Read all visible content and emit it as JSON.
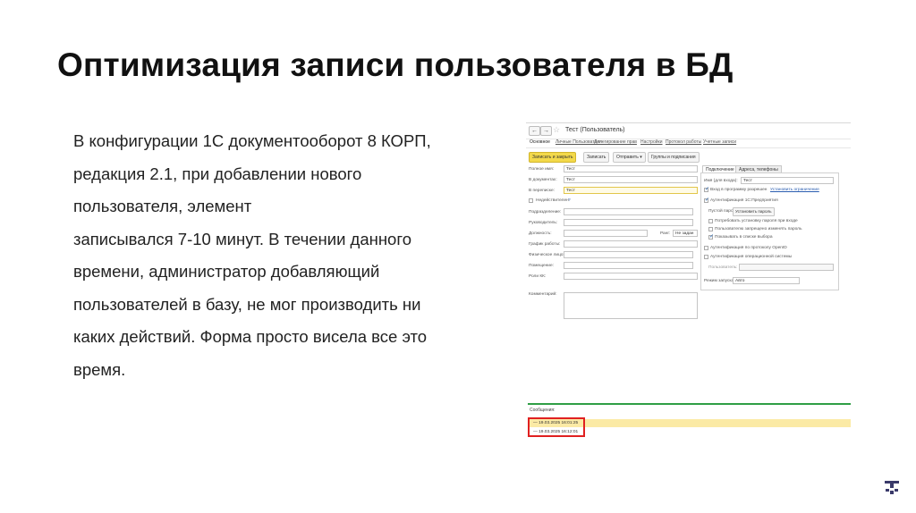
{
  "slide": {
    "title": "Оптимизация записи пользователя в БД",
    "body_lines": [
      "В конфигурации 1С документооборот 8 КОРП,",
      "редакция 2.1, при добавлении нового",
      "пользователя, элемент",
      "записывался 7-10 минут. В течении данного",
      "времени, администратор добавляющий",
      "пользователей в базу, не мог производить ни",
      "каких действий. Форма просто висела все это",
      "время."
    ]
  },
  "screenshot": {
    "nav_back": "←",
    "nav_forward": "→",
    "window_title": "Тест (Пользователь)",
    "tabs": [
      "Основное",
      "Личные Пользователя",
      "Делегирование прав",
      "Настройки",
      "Протокол работы",
      "Учетные записи"
    ],
    "buttons": {
      "save_close": "Записать и закрыть",
      "save": "Записать",
      "send": "Отправить",
      "groups": "Группы и подписания"
    },
    "left_form": {
      "full_name_label": "Полное имя:",
      "full_name_value": "Тест",
      "in_documents_label": "В документах:",
      "in_documents_value": "Тест",
      "in_correspondence_label": "В переписке:",
      "in_correspondence_value": "Тест",
      "invalid_label": "Недействителен",
      "invalid_hint": "?",
      "department_label": "Подразделение:",
      "manager_label": "Руководитель:",
      "position_label": "Должность:",
      "rank_label": "Ранг:",
      "rank_value": "Не задан",
      "schedule_label": "График работы:",
      "individual_label": "Физическое лицо:",
      "room_label": "Помещение:",
      "roles_label": "Роли КК:",
      "comment_label": "Комментарий:"
    },
    "right_tabs": [
      "Подключение",
      "Адреса, телефоны"
    ],
    "right_form": {
      "login_label": "Имя (для входа):",
      "login_value": "Тест",
      "access_label": "Вход в программу разрешен",
      "set_restriction": "Установить ограничение",
      "auth_1c_label": "Аутентификация 1С:Предприятия",
      "empty_password_label": "Пустой пароль",
      "set_password_btn": "Установить пароль",
      "require_password_change": "Потребовать установку пароля при входе",
      "forbid_password_change": "Пользователю запрещено изменять пароль",
      "show_in_list": "Показывать в списке выбора",
      "openid_auth": "Аутентификация по протоколу OpenID",
      "os_auth": "Аутентификация операционной системы",
      "os_user_label": "Пользователь:",
      "launch_mode_label": "Режим запуска:",
      "launch_mode_value": "Авто"
    },
    "messages": {
      "title": "Сообщения:",
      "items": [
        "19.03.2025 16:01:25",
        "19.03.2025 16:12:01"
      ]
    }
  },
  "colors": {
    "primary_button": "#f3d94a",
    "message_highlight": "#fbeaa5",
    "divider_green": "#2f9e45",
    "annotation_red": "#e02020",
    "link_blue": "#2a5db0"
  },
  "icons": [
    "back-arrow-icon",
    "forward-arrow-icon",
    "star-icon",
    "dropdown-icon",
    "logo-icon"
  ]
}
